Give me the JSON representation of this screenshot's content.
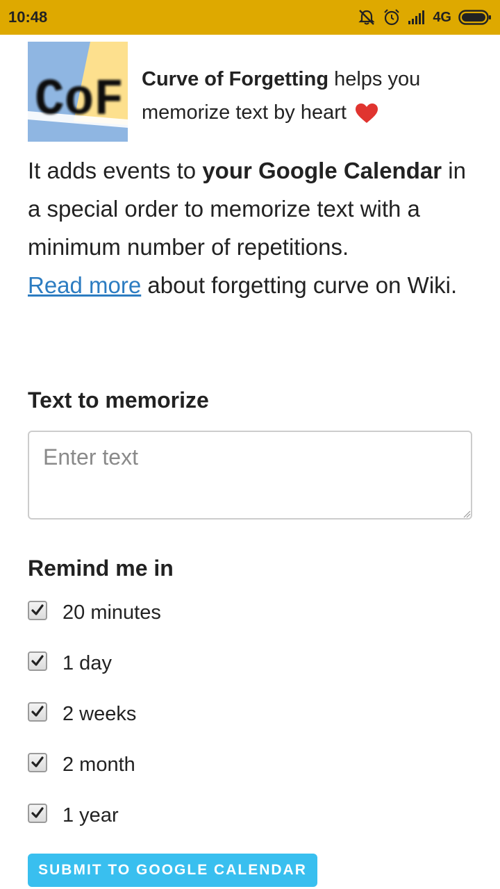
{
  "status_bar": {
    "time": "10:48",
    "network": "4G",
    "icons": [
      "mute-icon",
      "alarm-icon",
      "signal-icon",
      "battery-icon"
    ],
    "background": "#DEA900"
  },
  "intro": {
    "logo_text": "CoF",
    "app_name": "Curve of Forgetting",
    "tagline_rest_1": " helps you",
    "tagline_rest_2": "memorize text by heart"
  },
  "description": {
    "part1": "It adds events to ",
    "bold": "your Google Calendar",
    "part2": " in a special order to memorize text with a minimum number of repetitions.",
    "link": "Read more",
    "part3": " about forgetting curve on Wiki.",
    "link_color": "#2C7CC1"
  },
  "form": {
    "text_label": "Text to memorize",
    "text_placeholder": "Enter text",
    "text_value": "",
    "remind_label": "Remind me in",
    "options": [
      {
        "label": "20 minutes",
        "checked": true
      },
      {
        "label": "1 day",
        "checked": true
      },
      {
        "label": "2 weeks",
        "checked": true
      },
      {
        "label": "2 month",
        "checked": true
      },
      {
        "label": "1 year",
        "checked": true
      }
    ],
    "submit_label": "SUBMIT TO GOOGLE CALENDAR",
    "submit_color": "#39BFEF"
  }
}
